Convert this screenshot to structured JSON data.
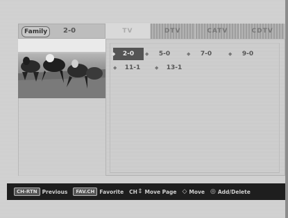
{
  "source": {
    "logo_label": "Family",
    "current_channel": "2-0"
  },
  "tabs": [
    {
      "label": "TV",
      "active": true
    },
    {
      "label": "DTV",
      "active": false
    },
    {
      "label": "CATV",
      "active": false
    },
    {
      "label": "CDTV",
      "active": false
    }
  ],
  "channels": {
    "rows": [
      [
        {
          "number": "2-0",
          "selected": true
        },
        {
          "number": "5-0",
          "selected": false
        },
        {
          "number": "7-0",
          "selected": false
        },
        {
          "number": "9-0",
          "selected": false
        }
      ],
      [
        {
          "number": "11-1",
          "selected": false
        },
        {
          "number": "13-1",
          "selected": false
        }
      ]
    ]
  },
  "footer": {
    "items": [
      {
        "key": "CH-RTN",
        "label": "Previous"
      },
      {
        "key": "FAV.CH",
        "label": "Favorite"
      },
      {
        "key": "CH",
        "label": "Move Page"
      },
      {
        "key": "◇",
        "label": "Move"
      },
      {
        "key": "◎",
        "label": "Add/Delete"
      }
    ]
  },
  "colors": {
    "background": "#d2d2d2",
    "footer_bg": "#1e1e1e",
    "selected_cell": "#545454"
  }
}
